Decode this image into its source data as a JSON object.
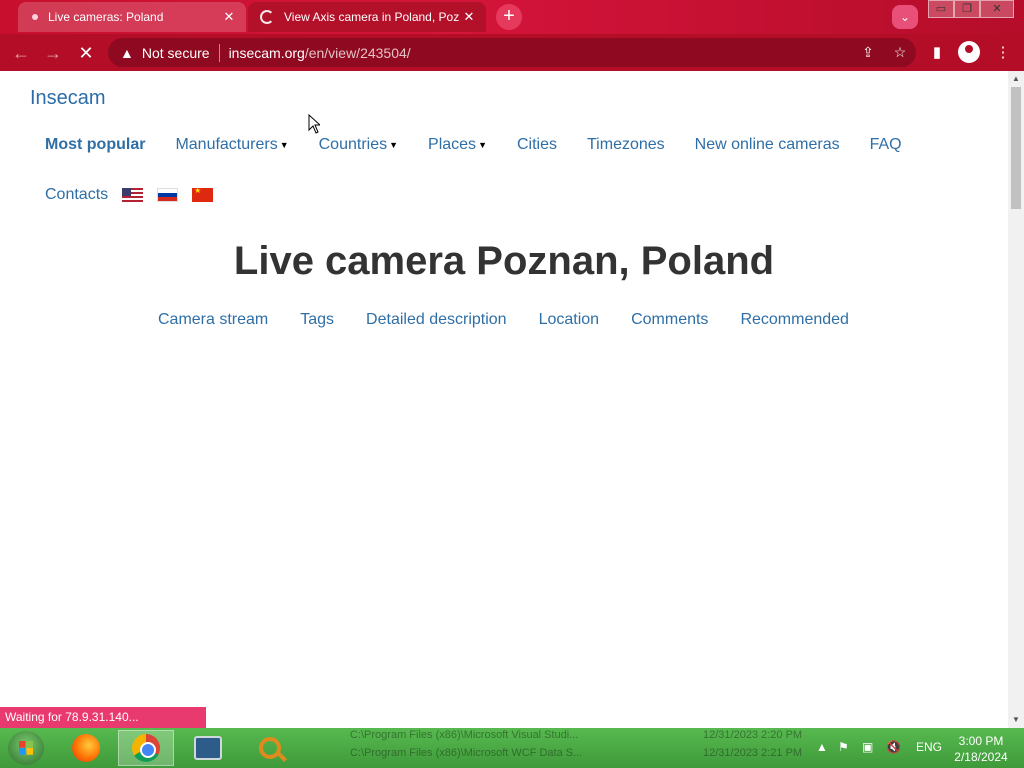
{
  "browser": {
    "tabs": [
      {
        "title": "Live cameras: Poland",
        "active": false
      },
      {
        "title": "View Axis camera in Poland, Pozn",
        "active": true
      }
    ],
    "new_tab": "+",
    "tab_search": "⌄",
    "window_controls": {
      "minimize": "▭",
      "restore": "❐",
      "close": "✕"
    },
    "address": {
      "security": "Not secure",
      "host": "insecam.org",
      "path": "/en/view/243504/"
    },
    "accent_color": "#c8102e"
  },
  "page": {
    "brand": "Insecam",
    "nav_row1": [
      {
        "label": "Most popular",
        "bold": true,
        "caret": false
      },
      {
        "label": "Manufacturers",
        "caret": true
      },
      {
        "label": "Countries",
        "caret": true
      },
      {
        "label": "Places",
        "caret": true
      },
      {
        "label": "Cities",
        "caret": false
      },
      {
        "label": "Timezones",
        "caret": false
      },
      {
        "label": "New online cameras",
        "caret": false
      },
      {
        "label": "FAQ",
        "caret": false
      }
    ],
    "nav_row2": {
      "contacts": "Contacts",
      "flags": [
        "us-flag-icon",
        "ru-flag-icon",
        "cn-flag-icon"
      ]
    },
    "headline": "Live camera Poznan, Poland",
    "subnav": [
      "Camera stream",
      "Tags",
      "Detailed description",
      "Location",
      "Comments",
      "Recommended"
    ],
    "link_color": "#2f6fa6"
  },
  "status": "Waiting for 78.9.31.140...",
  "taskbar": {
    "ghost_rows": [
      {
        "path": "C:\\Program Files (x86)\\Microsoft Visual Studi...",
        "date": "12/31/2023 2:20 PM"
      },
      {
        "path": "C:\\Program Files (x86)\\Microsoft WCF Data S...",
        "date": "12/31/2023 2:21 PM"
      }
    ],
    "language": "ENG",
    "time": "3:00 PM",
    "date": "2/18/2024"
  }
}
